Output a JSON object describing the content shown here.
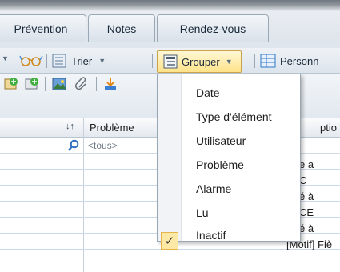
{
  "tabs": [
    {
      "label": "Prévention"
    },
    {
      "label": "Notes"
    },
    {
      "label": "Rendez-vous"
    }
  ],
  "toolbar": {
    "sort_label": "Trier",
    "group_label": "Grouper",
    "personalize_label": "Personn"
  },
  "grid": {
    "header_sort_indicator": "↓↑",
    "header_probleme": "Problème",
    "header_right_partial": "ptio",
    "filter_value": "<tous>",
    "right_cells": [
      "e a",
      "C",
      "é à",
      "CE",
      "é à",
      "[Motif] Fiè"
    ]
  },
  "menu": {
    "items": [
      {
        "label": "Date",
        "checked": false
      },
      {
        "label": "Type d'élément",
        "checked": false
      },
      {
        "label": "Utilisateur",
        "checked": false
      },
      {
        "label": "Problème",
        "checked": false
      },
      {
        "label": "Alarme",
        "checked": false
      },
      {
        "label": "Lu",
        "checked": false
      },
      {
        "label": "Inactif",
        "checked": true
      }
    ],
    "check_glyph": "✓"
  },
  "colors": {
    "accent": "#1f6fd1",
    "menu_check_bg": "#fde8a6"
  }
}
